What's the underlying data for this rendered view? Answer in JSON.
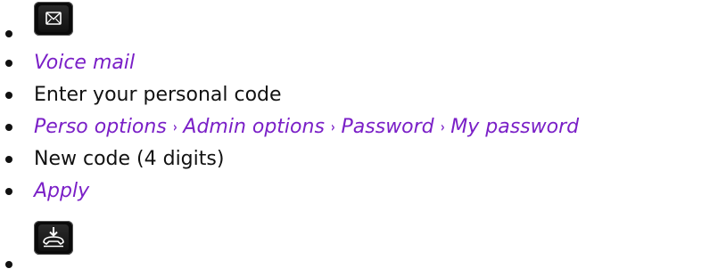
{
  "steps": [
    {
      "kind": "key",
      "icon": "envelope-icon"
    },
    {
      "kind": "menu",
      "text": "Voice mail"
    },
    {
      "kind": "plain",
      "text": "Enter your personal code"
    },
    {
      "kind": "path",
      "items": [
        "Perso options",
        "Admin options",
        "Password",
        "My password"
      ],
      "separator": "›"
    },
    {
      "kind": "plain",
      "text": "New code (4 digits)"
    },
    {
      "kind": "menu",
      "text": "Apply"
    },
    {
      "kind": "key",
      "icon": "hang-up-icon"
    }
  ],
  "colors": {
    "menu_text": "#7a1fc7",
    "body_text": "#111111",
    "key_background": "#0a0a0a"
  }
}
